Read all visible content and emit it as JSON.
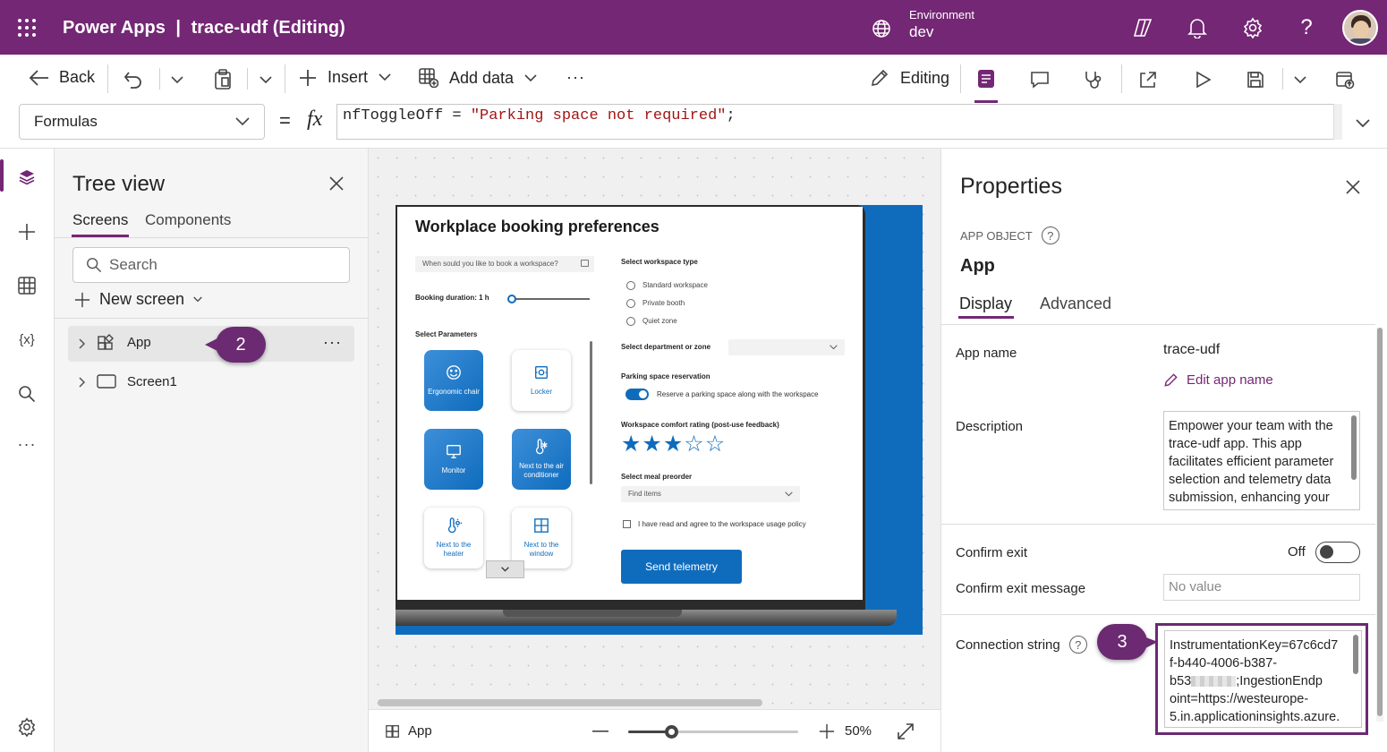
{
  "topbar": {
    "app_title": "Power Apps",
    "divider": "|",
    "doc_title": "trace-udf (Editing)",
    "env_label": "Environment",
    "env_value": "dev"
  },
  "command_bar": {
    "back": "Back",
    "insert": "Insert",
    "add_data": "Add data",
    "more": "···",
    "editing": "Editing"
  },
  "formula_bar": {
    "property": "Formulas",
    "equals": "=",
    "fx": "fx",
    "formula_name": "nfToggleOff",
    "formula_op": " = ",
    "formula_string": "\"Parking space not required\"",
    "formula_end": ";"
  },
  "tree_view": {
    "title": "Tree view",
    "tabs": [
      "Screens",
      "Components"
    ],
    "search_placeholder": "Search",
    "new_screen": "New screen",
    "items": [
      {
        "label": "App",
        "selected": true
      },
      {
        "label": "Screen1",
        "selected": false
      }
    ],
    "more": "···"
  },
  "callouts": {
    "app": "2",
    "conn": "3"
  },
  "app_preview": {
    "title": "Workplace booking preferences",
    "when_placeholder": "When sould you like to book a workspace?",
    "duration_label": "Booking duration: 1 h",
    "duration_fraction": 0.03,
    "params_label": "Select Parameters",
    "tiles": [
      {
        "label": "Ergonomic chair",
        "selected": true,
        "icon": "smile-icon"
      },
      {
        "label": "Locker",
        "selected": false,
        "icon": "locker-icon"
      },
      {
        "label": "Monitor",
        "selected": true,
        "icon": "monitor-icon"
      },
      {
        "label": "Next to the air conditioner",
        "selected": true,
        "icon": "thermometer-snow-icon"
      },
      {
        "label": "Next to the heater",
        "selected": false,
        "icon": "thermometer-sun-icon"
      },
      {
        "label": "Next to the window",
        "selected": false,
        "icon": "window-icon"
      }
    ],
    "workspace_type_label": "Select workspace type",
    "workspace_types": [
      "Standard workspace",
      "Private booth",
      "Quiet zone"
    ],
    "department_label": "Select department or zone",
    "parking_label": "Parking space reservation",
    "parking_toggle_text": "Reserve a parking space along with the workspace",
    "parking_on": true,
    "rating_label": "Workspace comfort rating (post-use feedback)",
    "rating": 3,
    "rating_max": 5,
    "meal_label": "Select meal preorder",
    "meal_placeholder": "Find items",
    "policy_text": "I have read and agree to the workspace usage policy",
    "send_button": "Send telemetry"
  },
  "status_bar": {
    "screen": "App",
    "zoom": "50%",
    "zoom_fraction": 0.5
  },
  "properties": {
    "title": "Properties",
    "object_type": "APP OBJECT",
    "object_name": "App",
    "tabs": [
      "Display",
      "Advanced"
    ],
    "app_name_label": "App name",
    "app_name_value": "trace-udf",
    "edit_app_name": "Edit app name",
    "description_label": "Description",
    "description_value": "Empower your team with the trace-udf app. This app facilitates efficient parameter selection and telemetry data submission, enhancing your",
    "confirm_exit_label": "Confirm exit",
    "confirm_exit_value": "Off",
    "confirm_exit_msg_label": "Confirm exit message",
    "confirm_exit_msg_placeholder": "No value",
    "connection_label": "Connection string",
    "connection_value_1": "InstrumentationKey=67c6cd7",
    "connection_value_2": "f-b440-4006-b387-",
    "connection_value_3a": "b53",
    "connection_value_3b": ";IngestionEndp",
    "connection_value_4": "oint=https://westeurope-",
    "connection_value_5": "5.in.applicationinsights.azure."
  },
  "colors": {
    "brand": "#742774",
    "accent": "#0f6cbd",
    "callout": "#6b2a72"
  }
}
